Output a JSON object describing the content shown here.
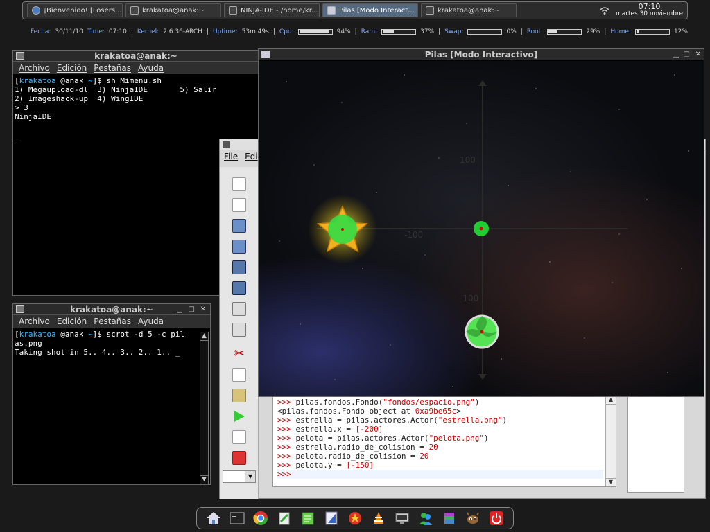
{
  "taskbar": {
    "tasks": [
      {
        "label": "¡Bienvenido! [Losers...",
        "icon": "browser-icon"
      },
      {
        "label": "krakatoa@anak:~",
        "icon": "terminal-icon"
      },
      {
        "label": "NINJA-IDE - /home/kr...",
        "icon": "ninja-ide-icon"
      },
      {
        "label": "Pilas [Modo Interact...",
        "icon": "pilas-window-icon"
      },
      {
        "label": "krakatoa@anak:~",
        "icon": "terminal-icon"
      }
    ],
    "clock_time": "07:10",
    "clock_date": "martes 30 noviembre"
  },
  "conky": {
    "fecha_label": "Fecha:",
    "fecha": "30/11/10",
    "time_label": "Time:",
    "time": "07:10",
    "kernel_label": "Kernel:",
    "kernel": "2.6.36-ARCH",
    "uptime_label": "Uptime:",
    "uptime": "53m 49s",
    "cpu_label": "Cpu:",
    "cpu": 94,
    "cpu_text": "94%",
    "ram_label": "Ram:",
    "ram": 37,
    "ram_text": "37%",
    "swap_label": "Swap:",
    "swap": 0,
    "swap_text": "0%",
    "root_label": "Root:",
    "root": 29,
    "root_text": "29%",
    "home_label": "Home:",
    "home": 12,
    "home_text": "12%"
  },
  "term1": {
    "title": "krakatoa@anak:~",
    "menu": [
      "Archivo",
      "Edición",
      "Pestañas",
      "Ayuda"
    ],
    "prompt_user": "krakatoa",
    "prompt_host": "@anak",
    "prompt_dir": "~",
    "command": "sh Mimenu.sh",
    "lines": [
      "1) Megaupload-dl  3) NinjaIDE       5) Salir",
      "2) Imageshack-up  4) WingIDE",
      "> 3",
      "NinjaIDE",
      "",
      "_"
    ]
  },
  "term2": {
    "title": "krakatoa@anak:~",
    "menu": [
      "Archivo",
      "Edición",
      "Pestañas",
      "Ayuda"
    ],
    "prompt_user": "krakatoa",
    "prompt_host": "@anak",
    "prompt_dir": "~",
    "command": "scrot -d 5 -c pil",
    "line2": "as.png",
    "line3": "Taking shot in 5.. 4.. 3.. 2.. 1.. _"
  },
  "ide": {
    "menu": [
      "File",
      "Edi"
    ],
    "console": [
      {
        "prompt": ">>>",
        "code": " pilas.fondos.Fondo(",
        "str": "\"fondos/espacio.png\"",
        "tail": ")"
      },
      {
        "prompt": "",
        "code": "<pilas.fondos.Fondo object at ",
        "str": "0xa9be65c",
        "tail": ">"
      },
      {
        "prompt": ">>>",
        "code": " estrella = pilas.actores.Actor(",
        "str": "\"estrella.png\"",
        "tail": ")"
      },
      {
        "prompt": ">>>",
        "code": " estrella.x = ",
        "str": "[-200]",
        "tail": ""
      },
      {
        "prompt": ">>>",
        "code": " pelota = pilas.actores.Actor(",
        "str": "\"pelota.png\"",
        "tail": ")"
      },
      {
        "prompt": ">>>",
        "code": " estrella.radio_de_colision = ",
        "str": "20",
        "tail": ""
      },
      {
        "prompt": ">>>",
        "code": " pelota.radio_de_colision = ",
        "str": "20",
        "tail": ""
      },
      {
        "prompt": ">>>",
        "code": " pelota.y = ",
        "str": "[-150]",
        "tail": ""
      },
      {
        "prompt": ">>>",
        "code": "",
        "str": "",
        "tail": ""
      }
    ]
  },
  "pilas": {
    "title": "Pilas [Modo Interactivo]",
    "labels": {
      "y_pos": "100",
      "x_neg": "-100",
      "y_neg": "-100"
    }
  },
  "dock": [
    "home-icon",
    "terminal-icon",
    "chrome-icon",
    "editor-icon",
    "notes-icon",
    "ide-icon",
    "game-icon",
    "vlc-icon",
    "monitor-icon",
    "messenger-icon",
    "archive-icon",
    "gimp-icon",
    "power-icon"
  ]
}
